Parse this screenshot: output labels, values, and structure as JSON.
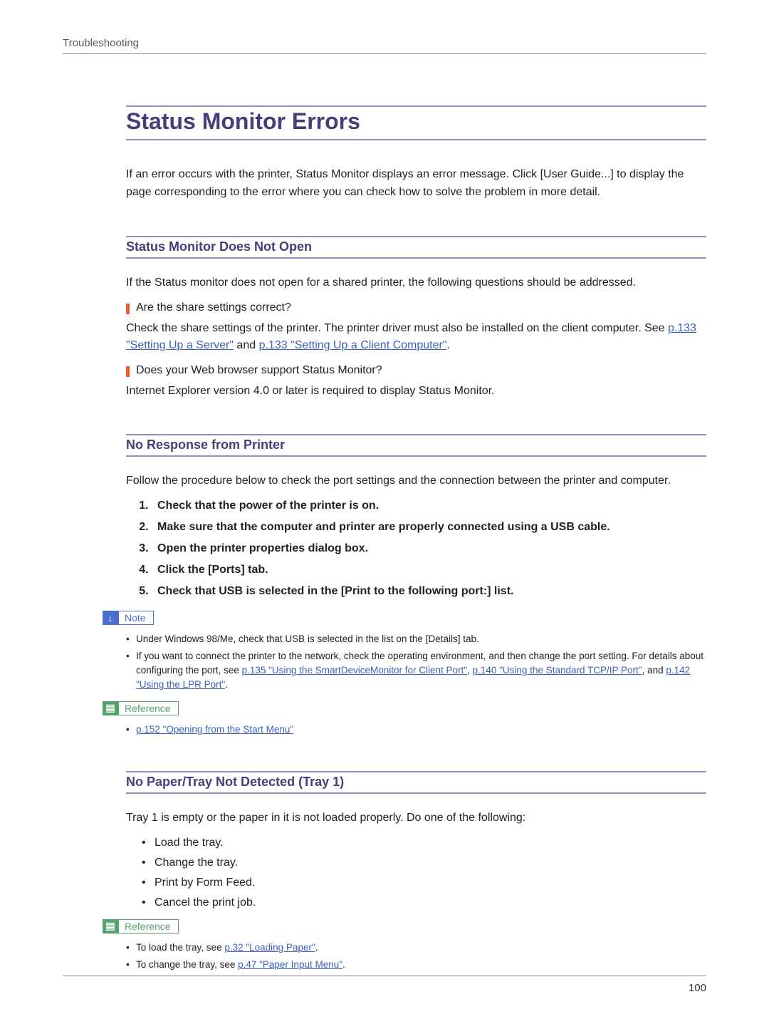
{
  "header": {
    "section": "Troubleshooting"
  },
  "title": "Status Monitor Errors",
  "intro": "If an error occurs with the printer, Status Monitor displays an error message. Click [User Guide...] to display the page corresponding to the error where you can check how to solve the problem in more detail.",
  "sec1": {
    "heading": "Status Monitor Does Not Open",
    "lead": "If the Status monitor does not open for a shared printer, the following questions should be addressed.",
    "q1": "Are the share settings correct?",
    "p1a": "Check the share settings of the printer. The printer driver must also be installed on the client computer. See ",
    "link1": "p.133 \"Setting Up a Server\"",
    "p1b": " and ",
    "link2": "p.133 \"Setting Up a Client Computer\"",
    "p1c": ".",
    "q2": "Does your Web browser support Status Monitor?",
    "p2": "Internet Explorer version 4.0 or later is required to display Status Monitor."
  },
  "sec2": {
    "heading": "No Response from Printer",
    "lead": "Follow the procedure below to check the port settings and the connection between the printer and computer.",
    "steps": [
      "Check that the power of the printer is on.",
      "Make sure that the computer and printer are properly connected using a USB cable.",
      "Open the printer properties dialog box.",
      "Click the [Ports] tab.",
      "Check that USB is selected in the [Print to the following port:] list."
    ],
    "note_label": "Note",
    "notes": {
      "n1": "Under Windows 98/Me, check that USB is selected in the list on the [Details] tab.",
      "n2a": "If you want to connect the printer to the network, check the operating environment, and then change the port setting. For details about configuring the port, see ",
      "n2_link1": "p.135 \"Using the SmartDeviceMonitor for Client Port\"",
      "n2b": ", ",
      "n2_link2": "p.140 \"Using the Standard TCP/IP Port\"",
      "n2c": ", and ",
      "n2_link3": "p.142 \"Using the LPR Port\"",
      "n2d": "."
    },
    "ref_label": "Reference",
    "refs": {
      "r1": "p.152 \"Opening from the Start Menu\""
    }
  },
  "sec3": {
    "heading": "No Paper/Tray Not Detected (Tray 1)",
    "lead": "Tray 1 is empty or the paper in it is not loaded properly. Do one of the following:",
    "items": [
      "Load the tray.",
      "Change the tray.",
      "Print by Form Feed.",
      "Cancel the print job."
    ],
    "ref_label": "Reference",
    "refs": {
      "r1a": "To load the tray, see ",
      "r1_link": "p.32 \"Loading Paper\"",
      "r1b": ".",
      "r2a": "To change the tray, see ",
      "r2_link": "p.47 \"Paper Input Menu\"",
      "r2b": "."
    }
  },
  "page_number": "100"
}
